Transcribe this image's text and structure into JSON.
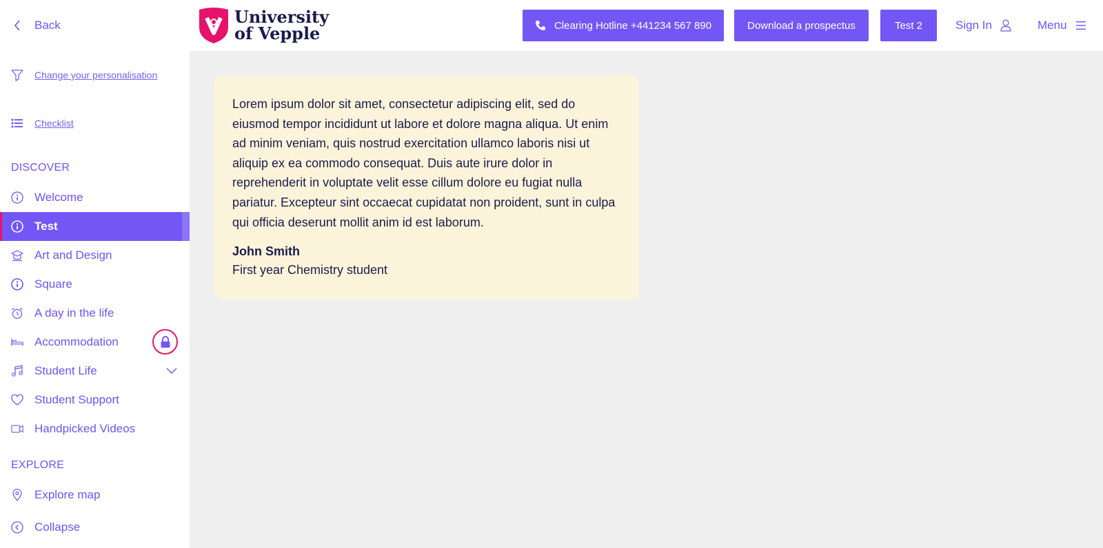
{
  "colors": {
    "accent": "#7357f5",
    "accent_text": "#6c55f2",
    "brand_red": "#e5136a",
    "card_bg": "#fcf4da",
    "canvas": "#efefef",
    "ink": "#1b1b4b"
  },
  "sidebar": {
    "back_label": "Back",
    "personalisation_label": "Change your personalisation",
    "checklist_label": "Checklist",
    "discover_heading": "DISCOVER",
    "discover_items": [
      {
        "label": "Welcome",
        "icon": "info-icon"
      },
      {
        "label": "Test",
        "icon": "info-icon",
        "active": true
      },
      {
        "label": "Art and Design",
        "icon": "graduation-icon"
      },
      {
        "label": "Square",
        "icon": "info-icon"
      },
      {
        "label": "A day in the life",
        "icon": "alarm-clock-icon"
      },
      {
        "label": "Accommodation",
        "icon": "bed-icon",
        "locked": true
      },
      {
        "label": "Student Life",
        "icon": "music-icon",
        "expandable": true
      },
      {
        "label": "Student Support",
        "icon": "heart-icon"
      },
      {
        "label": "Handpicked Videos",
        "icon": "video-icon"
      }
    ],
    "explore_heading": "EXPLORE",
    "explore_items": [
      {
        "label": "Explore map",
        "icon": "map-pin-icon"
      },
      {
        "label": "Collapse",
        "icon": "chevron-left-circle-icon"
      }
    ]
  },
  "header": {
    "logo_line1": "University",
    "logo_line2": "of Vepple",
    "hotline_label": "Clearing Hotline +441234 567 890",
    "prospectus_label": "Download a prospectus",
    "test2_label": "Test 2",
    "signin_label": "Sign In",
    "menu_label": "Menu"
  },
  "main": {
    "quote": "Lorem ipsum dolor sit amet, consectetur adipiscing elit, sed do eiusmod tempor incididunt ut labore et dolore magna aliqua. Ut enim ad minim veniam, quis nostrud exercitation ullamco laboris nisi ut aliquip ex ea commodo consequat. Duis aute irure dolor in reprehenderit in voluptate velit esse cillum dolore eu fugiat nulla pariatur. Excepteur sint occaecat cupidatat non proident, sunt in culpa qui officia deserunt mollit anim id est laborum.",
    "author": "John Smith",
    "role": "First year Chemistry student"
  }
}
